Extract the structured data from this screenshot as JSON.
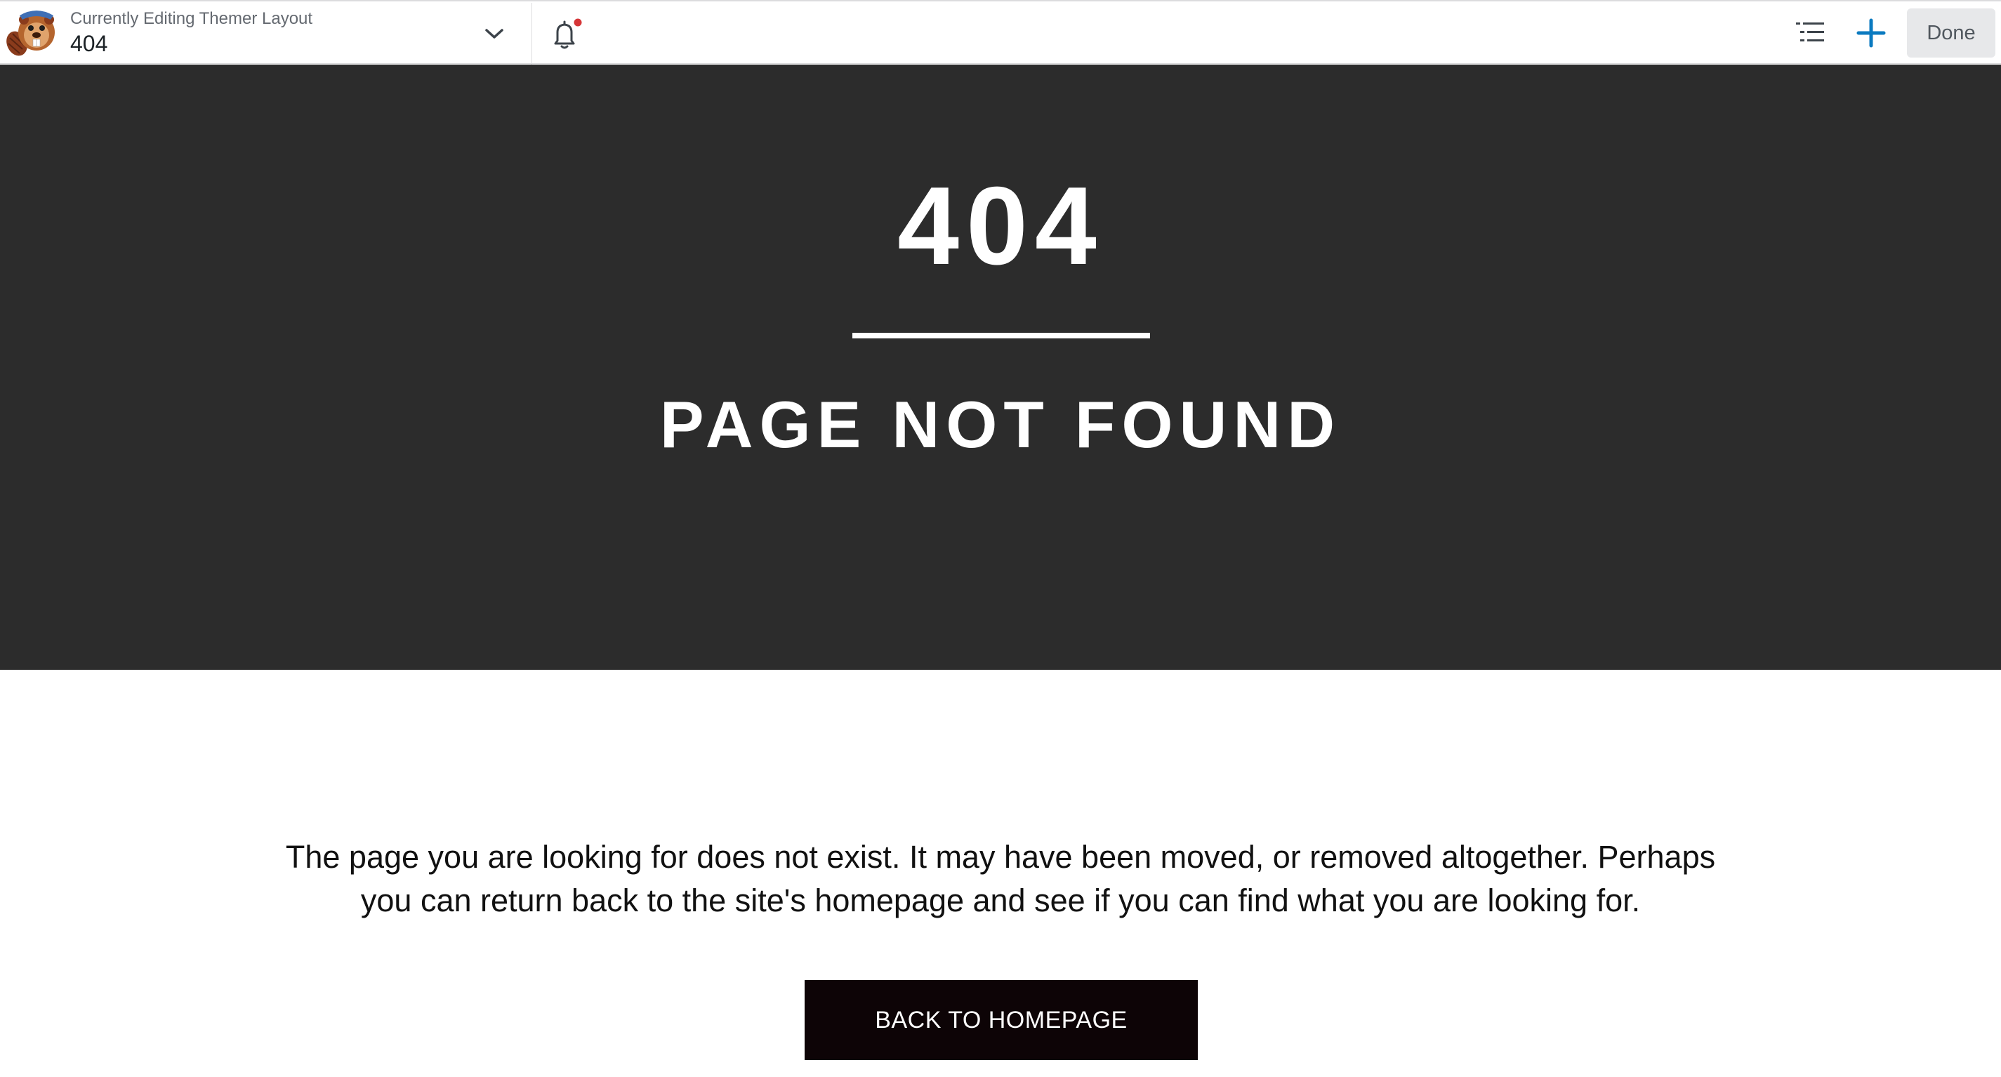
{
  "toolbar": {
    "editing_label": "Currently Editing Themer Layout",
    "layout_name": "404",
    "done_label": "Done",
    "icons": {
      "logo": "beaver-logo-icon",
      "dropdown": "chevron-down-icon",
      "notifications": "bell-icon",
      "outline": "outline-list-icon",
      "add": "plus-icon"
    },
    "colors": {
      "accent": "#0a7ac0",
      "notification_dot": "#d63638"
    }
  },
  "hero": {
    "code": "404",
    "subtitle": "PAGE NOT FOUND",
    "background": "#2c2c2c"
  },
  "content": {
    "message": "The page you are looking for does not exist. It may have been moved, or removed altogether. Perhaps you can return back to the site's homepage and see if you can find what you are looking for.",
    "button_label": "BACK TO HOMEPAGE"
  }
}
